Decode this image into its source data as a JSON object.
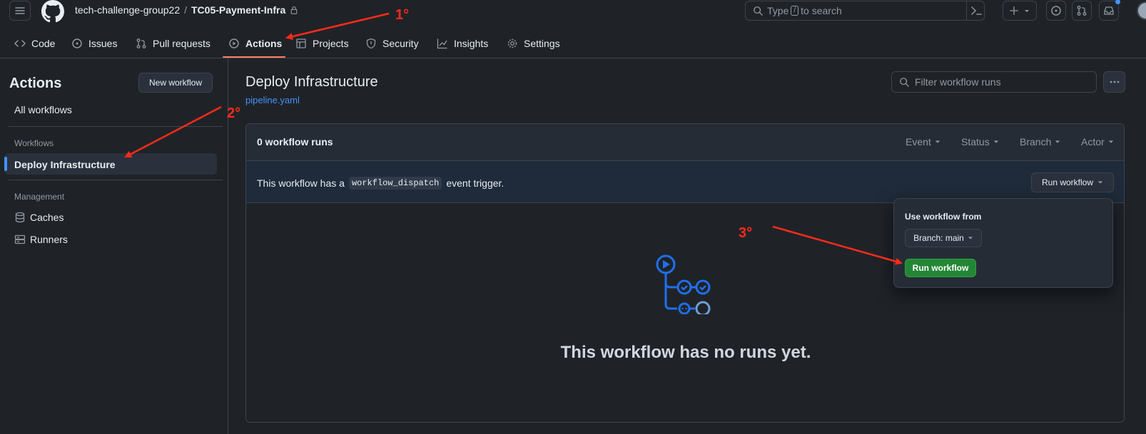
{
  "header": {
    "owner": "tech-challenge-group22",
    "separator": "/",
    "repo": "TC05-Payment-Infra",
    "search_prefix": "Type",
    "search_key": "/",
    "search_suffix": "to search"
  },
  "nav": {
    "tabs": [
      {
        "label": "Code"
      },
      {
        "label": "Issues"
      },
      {
        "label": "Pull requests"
      },
      {
        "label": "Actions"
      },
      {
        "label": "Projects"
      },
      {
        "label": "Security"
      },
      {
        "label": "Insights"
      },
      {
        "label": "Settings"
      }
    ],
    "active": "Actions"
  },
  "sidebar": {
    "title": "Actions",
    "new_workflow": "New workflow",
    "all_workflows": "All workflows",
    "workflows_heading": "Workflows",
    "workflow_item": "Deploy Infrastructure",
    "management_heading": "Management",
    "caches": "Caches",
    "runners": "Runners"
  },
  "main": {
    "title": "Deploy Infrastructure",
    "file_link": "pipeline.yaml",
    "filter_placeholder": "Filter workflow runs",
    "runs_count": "0 workflow runs",
    "filters": [
      "Event",
      "Status",
      "Branch",
      "Actor"
    ],
    "dispatch_prefix": "This workflow has a",
    "dispatch_code": "workflow_dispatch",
    "dispatch_suffix": "event trigger.",
    "run_workflow_button": "Run workflow",
    "empty_message": "This workflow has no runs yet."
  },
  "popover": {
    "label": "Use workflow from",
    "branch_button": "Branch: main",
    "run_button": "Run workflow"
  },
  "annotations": {
    "step1": "1°",
    "step2": "2°",
    "step3": "3°",
    "color": "#ff2a1a"
  },
  "colors": {
    "background": "#1f2328",
    "border": "#3d444d",
    "accent_link": "#4493f8",
    "active_tab_underline": "#f78166",
    "run_button_green": "#238636"
  }
}
